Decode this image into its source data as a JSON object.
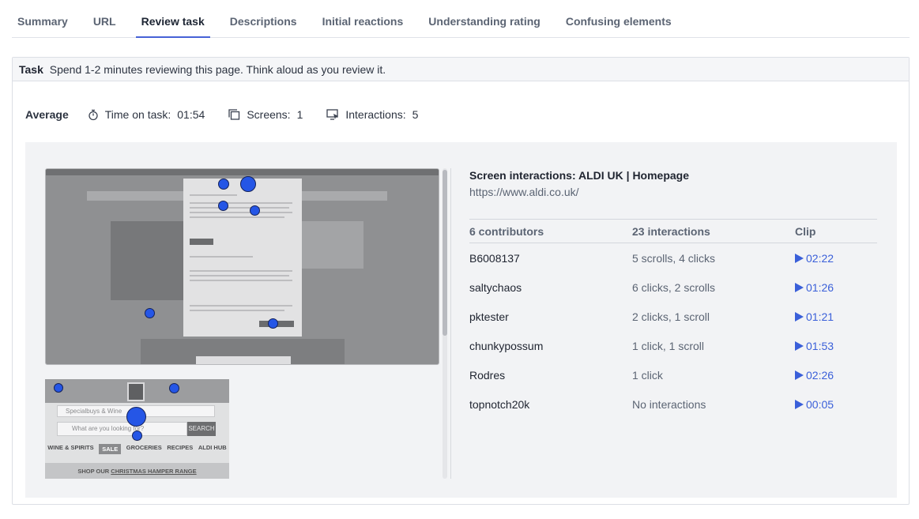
{
  "tabs": [
    "Summary",
    "URL",
    "Review task",
    "Descriptions",
    "Initial reactions",
    "Understanding rating",
    "Confusing elements"
  ],
  "active_tab": "Review task",
  "task": {
    "label": "Task",
    "text": "Spend 1-2 minutes reviewing this page. Think aloud as you review it."
  },
  "average": {
    "label": "Average",
    "time_label": "Time on task:",
    "time_value": "01:54",
    "screens_label": "Screens:",
    "screens_value": "1",
    "interactions_label": "Interactions:",
    "interactions_value": "5"
  },
  "screen": {
    "title": "Screen interactions: ALDI UK | Homepage",
    "url": "https://www.aldi.co.uk/"
  },
  "mobile_preview": {
    "select_text": "Specialbuys & Wine",
    "search_placeholder": "What are you looking for?",
    "search_button": "SEARCH",
    "categories": [
      "WINE & SPIRITS",
      "SALE",
      "GROCERIES",
      "RECIPES",
      "ALDI HUB"
    ],
    "footer_prefix": "SHOP OUR ",
    "footer_link": "CHRISTMAS HAMPER RANGE"
  },
  "table": {
    "headers": [
      "6 contributors",
      "23 interactions",
      "Clip"
    ],
    "rows": [
      {
        "name": "B6008137",
        "interactions": "5 scrolls, 4 clicks",
        "clip": "02:22"
      },
      {
        "name": "saltychaos",
        "interactions": "6 clicks, 2 scrolls",
        "clip": "01:26"
      },
      {
        "name": "pktester",
        "interactions": "2 clicks, 1 scroll",
        "clip": "01:21"
      },
      {
        "name": "chunkypossum",
        "interactions": "1 click, 1 scroll",
        "clip": "01:53"
      },
      {
        "name": "Rodres",
        "interactions": "1 click",
        "clip": "02:26"
      },
      {
        "name": "topnotch20k",
        "interactions": "No interactions",
        "clip": "00:05"
      }
    ]
  },
  "colors": {
    "accent": "#4662d6",
    "link": "#3a5fd9",
    "dot": "#2556e6"
  }
}
